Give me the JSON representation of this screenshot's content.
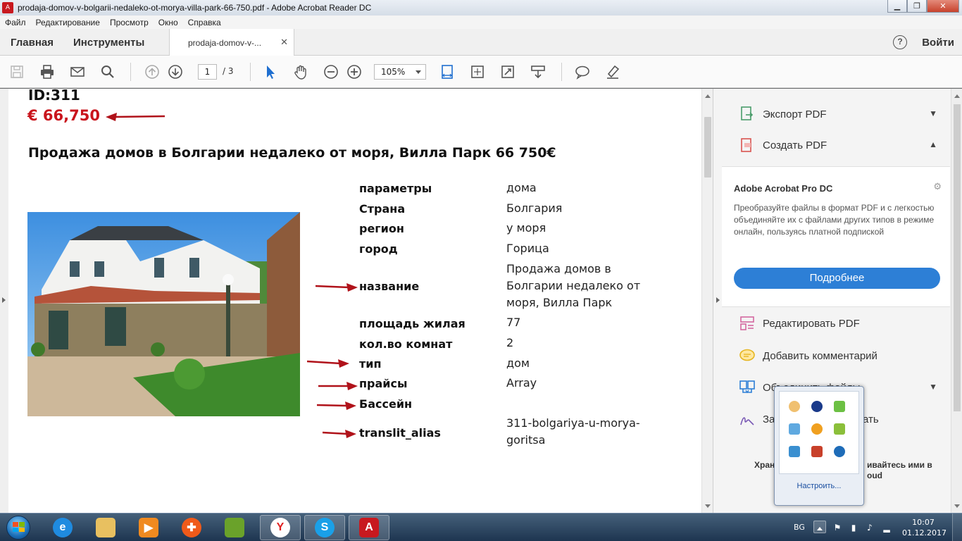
{
  "window": {
    "title": "prodaja-domov-v-bolgarii-nedaleko-ot-morya-villa-park-66-750.pdf - Adobe Acrobat Reader DC"
  },
  "menu": [
    "Файл",
    "Редактирование",
    "Просмотр",
    "Окно",
    "Справка"
  ],
  "tabs": {
    "home": "Главная",
    "tools": "Инструменты",
    "document": "prodaja-domov-v-...",
    "signin": "Войти"
  },
  "toolbar": {
    "page_current": "1",
    "page_total": "/ 3",
    "zoom": "105%"
  },
  "document": {
    "id_label": "ID:311",
    "price": "€ 66,750",
    "heading": "Продажа домов в Болгарии недалеко от моря, Вилла Парк 66 750€",
    "specs": [
      {
        "key": "параметры",
        "value": "дома"
      },
      {
        "key": "Страна",
        "value": "Болгария"
      },
      {
        "key": "регион",
        "value": "у моря"
      },
      {
        "key": "город",
        "value": "Горица"
      },
      {
        "key": "название",
        "value": "Продажа домов в Болгарии недалеко от моря, Вилла Парк"
      },
      {
        "key": "площадь жилая",
        "value": "77"
      },
      {
        "key": "кол.во комнат",
        "value": "2"
      },
      {
        "key": "тип",
        "value": "дом"
      },
      {
        "key": "прайсы",
        "value": "Array"
      },
      {
        "key": "Бассейн",
        "value": ""
      },
      {
        "key": "translit_alias",
        "value": "311-bolgariya-u-morya-goritsa"
      }
    ]
  },
  "right_panel": {
    "export_pdf": "Экспорт PDF",
    "create_pdf": "Создать PDF",
    "promo_title": "Adobe Acrobat Pro DC",
    "promo_text": "Преобразуйте файлы в формат PDF и с легкостью объединяйте их с файлами других типов в режиме онлайн, пользуясь платной подпиской",
    "promo_button": "Подробнее",
    "edit_pdf": "Редактировать PDF",
    "add_comment": "Добавить комментарий",
    "combine_files": "Объединить файлы",
    "fill_sign_partial": "За",
    "fill_sign_partial2": "ать",
    "cloud_left": "Хран",
    "cloud_right": "ивайтесь ими в",
    "cloud_right2": "oud"
  },
  "tray_popup": {
    "customize": "Настроить..."
  },
  "taskbar": {
    "language": "BG",
    "time": "10:07",
    "date": "01.12.2017"
  },
  "colors": {
    "accent_blue": "#2d7fd6",
    "price_red": "#c9141c"
  }
}
